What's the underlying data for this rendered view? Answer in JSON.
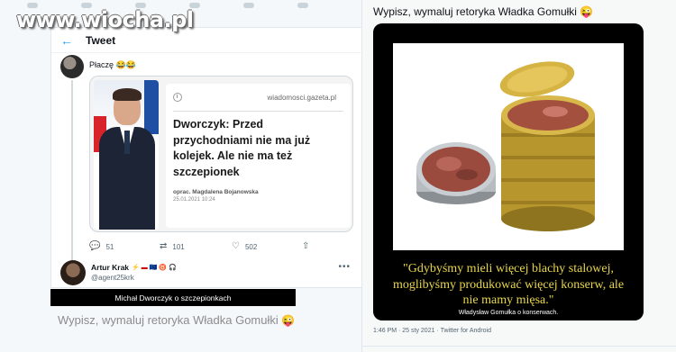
{
  "watermark": "www.wiocha.pl",
  "tweet": {
    "header_title": "Tweet",
    "caption": "Płaczę 😂😂",
    "embed": {
      "source": "wiadomosci.gazeta.pl",
      "headline": "Dworczyk: Przed przychodniami nie ma już kolejek. Ale nie ma też szczepionek",
      "byline": "oprac. Magdalena Bojanowska",
      "date": "25.01.2021 10:24"
    },
    "stats": {
      "replies": "51",
      "retweets": "101",
      "likes": "502"
    },
    "reply": {
      "name": "Artur Krak",
      "emojis": "⚡ ▬ 🇪🇺 ♉ 🎧",
      "handle": "@agent25krk",
      "more": "•••"
    }
  },
  "caption_bar": "Michał Dworczyk o szczepionkach",
  "left_bottom_text": "Wypisz, wymaluj retoryka Władka Gomułki",
  "right_top_text": "Wypisz, wymaluj retoryka Władka Gomułki",
  "emoji_wink": "😜",
  "poster": {
    "quote": "\"Gdybyśmy mieli więcej blachy stalowej, moglibyśmy produkować więcej konserw, ale nie mamy mięsa.\"",
    "author": "Władysław Gomułka o konserwach."
  },
  "meta": "1:46 PM · 25 sty 2021 · Twitter for Android",
  "colors": {
    "accent": "#1d9bf0",
    "poster_text": "#e8d64a"
  }
}
